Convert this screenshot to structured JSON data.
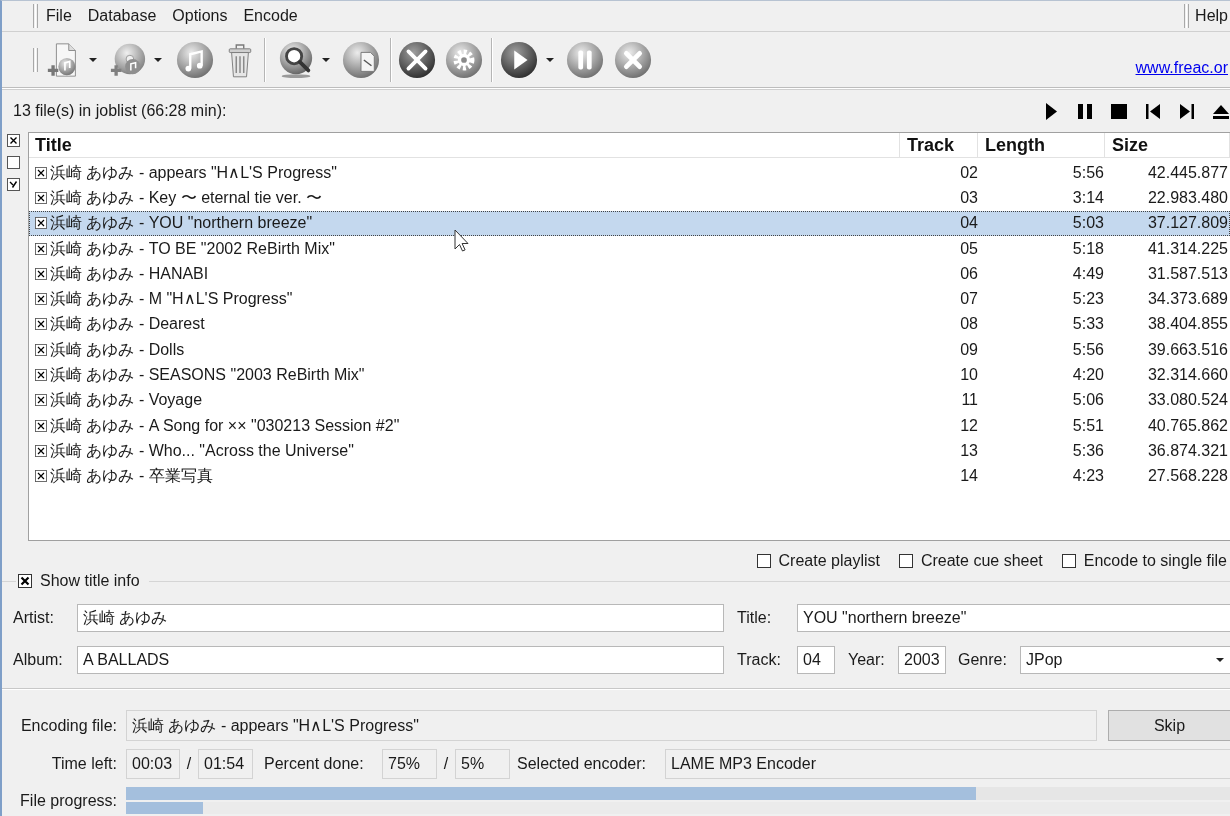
{
  "menu_bar": {
    "items": [
      "File",
      "Database",
      "Options",
      "Encode"
    ],
    "help": "Help"
  },
  "toolbar": {
    "link": "www.freac.or"
  },
  "joblist": {
    "summary": "13 file(s) in joblist (66:28 min):",
    "columns": [
      "Title",
      "Track",
      "Length",
      "Size"
    ],
    "rows": [
      {
        "title": "浜崎 あゆみ - appears \"H∧L'S Progress\"",
        "track": "02",
        "length": "5:56",
        "size": "42.445.877",
        "checked": true,
        "selected": false
      },
      {
        "title": "浜崎 あゆみ - Key 〜 eternal tie ver. 〜",
        "track": "03",
        "length": "3:14",
        "size": "22.983.480",
        "checked": true,
        "selected": false
      },
      {
        "title": "浜崎 あゆみ - YOU \"northern breeze\"",
        "track": "04",
        "length": "5:03",
        "size": "37.127.809",
        "checked": true,
        "selected": true
      },
      {
        "title": "浜崎 あゆみ - TO BE \"2002 ReBirth Mix\"",
        "track": "05",
        "length": "5:18",
        "size": "41.314.225",
        "checked": true,
        "selected": false
      },
      {
        "title": "浜崎 あゆみ - HANABI",
        "track": "06",
        "length": "4:49",
        "size": "31.587.513",
        "checked": true,
        "selected": false
      },
      {
        "title": "浜崎 あゆみ - M \"H∧L'S Progress\"",
        "track": "07",
        "length": "5:23",
        "size": "34.373.689",
        "checked": true,
        "selected": false
      },
      {
        "title": "浜崎 あゆみ - Dearest",
        "track": "08",
        "length": "5:33",
        "size": "38.404.855",
        "checked": true,
        "selected": false
      },
      {
        "title": "浜崎 あゆみ - Dolls",
        "track": "09",
        "length": "5:56",
        "size": "39.663.516",
        "checked": true,
        "selected": false
      },
      {
        "title": "浜崎 あゆみ - SEASONS \"2003 ReBirth Mix\"",
        "track": "10",
        "length": "4:20",
        "size": "32.314.660",
        "checked": true,
        "selected": false
      },
      {
        "title": "浜崎 あゆみ - Voyage",
        "track": "11",
        "length": "5:06",
        "size": "33.080.524",
        "checked": true,
        "selected": false
      },
      {
        "title": "浜崎 あゆみ - A Song for ×× \"030213 Session #2\"",
        "track": "12",
        "length": "5:51",
        "size": "40.765.862",
        "checked": true,
        "selected": false
      },
      {
        "title": "浜崎 あゆみ - Who... \"Across the Universe\"",
        "track": "13",
        "length": "5:36",
        "size": "36.874.321",
        "checked": true,
        "selected": false
      },
      {
        "title": "浜崎 あゆみ - 卒業写真",
        "track": "14",
        "length": "4:23",
        "size": "27.568.228",
        "checked": true,
        "selected": false
      }
    ]
  },
  "options": [
    {
      "label": "Create playlist",
      "checked": false
    },
    {
      "label": "Create cue sheet",
      "checked": false
    },
    {
      "label": "Encode to single file",
      "checked": false
    }
  ],
  "title_info": {
    "toggle": {
      "label": "Show title info",
      "checked": true
    },
    "artist": {
      "label": "Artist:",
      "value": "浜崎 あゆみ"
    },
    "title": {
      "label": "Title:",
      "value": "YOU \"northern breeze\""
    },
    "album": {
      "label": "Album:",
      "value": "A BALLADS"
    },
    "track": {
      "label": "Track:",
      "value": "04"
    },
    "year": {
      "label": "Year:",
      "value": "2003"
    },
    "genre": {
      "label": "Genre:",
      "value": "JPop"
    }
  },
  "encoding": {
    "file": {
      "label": "Encoding file:",
      "value": "浜崎 あゆみ - appears \"H∧L'S Progress\""
    },
    "skip_button": "Skip",
    "time_left": {
      "label": "Time left:",
      "values": [
        "00:03",
        "01:54"
      ],
      "separator": "/"
    },
    "percent_done": {
      "label": "Percent done:",
      "values": [
        "75%",
        "5%"
      ],
      "separator": "/"
    },
    "selected_encoder": {
      "label": "Selected encoder:",
      "value": "LAME MP3 Encoder"
    },
    "progress": {
      "label": "File progress:",
      "bars": [
        {
          "level": 0.77
        },
        {
          "level": 0.07
        }
      ]
    }
  }
}
